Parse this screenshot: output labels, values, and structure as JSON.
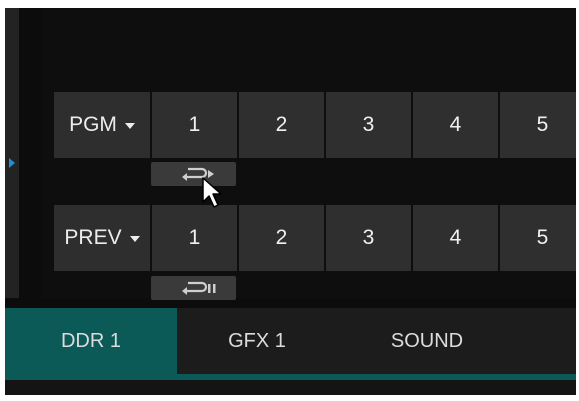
{
  "program_row": {
    "bus_label": "PGM",
    "sources": [
      "1",
      "2",
      "3",
      "4",
      "5"
    ],
    "loop_icon": "loop-play-icon"
  },
  "preview_row": {
    "bus_label": "PREV",
    "sources": [
      "1",
      "2",
      "3",
      "4",
      "5"
    ],
    "loop_icon": "loop-pause-icon"
  },
  "tabs": [
    {
      "label": "DDR 1",
      "active": true
    },
    {
      "label": "GFX 1",
      "active": false
    },
    {
      "label": "SOUND",
      "active": false
    }
  ],
  "colors": {
    "accent_teal": "#0c5a57",
    "selection_marker": "#1e8fd6",
    "button_bg": "#2f2f2f"
  }
}
